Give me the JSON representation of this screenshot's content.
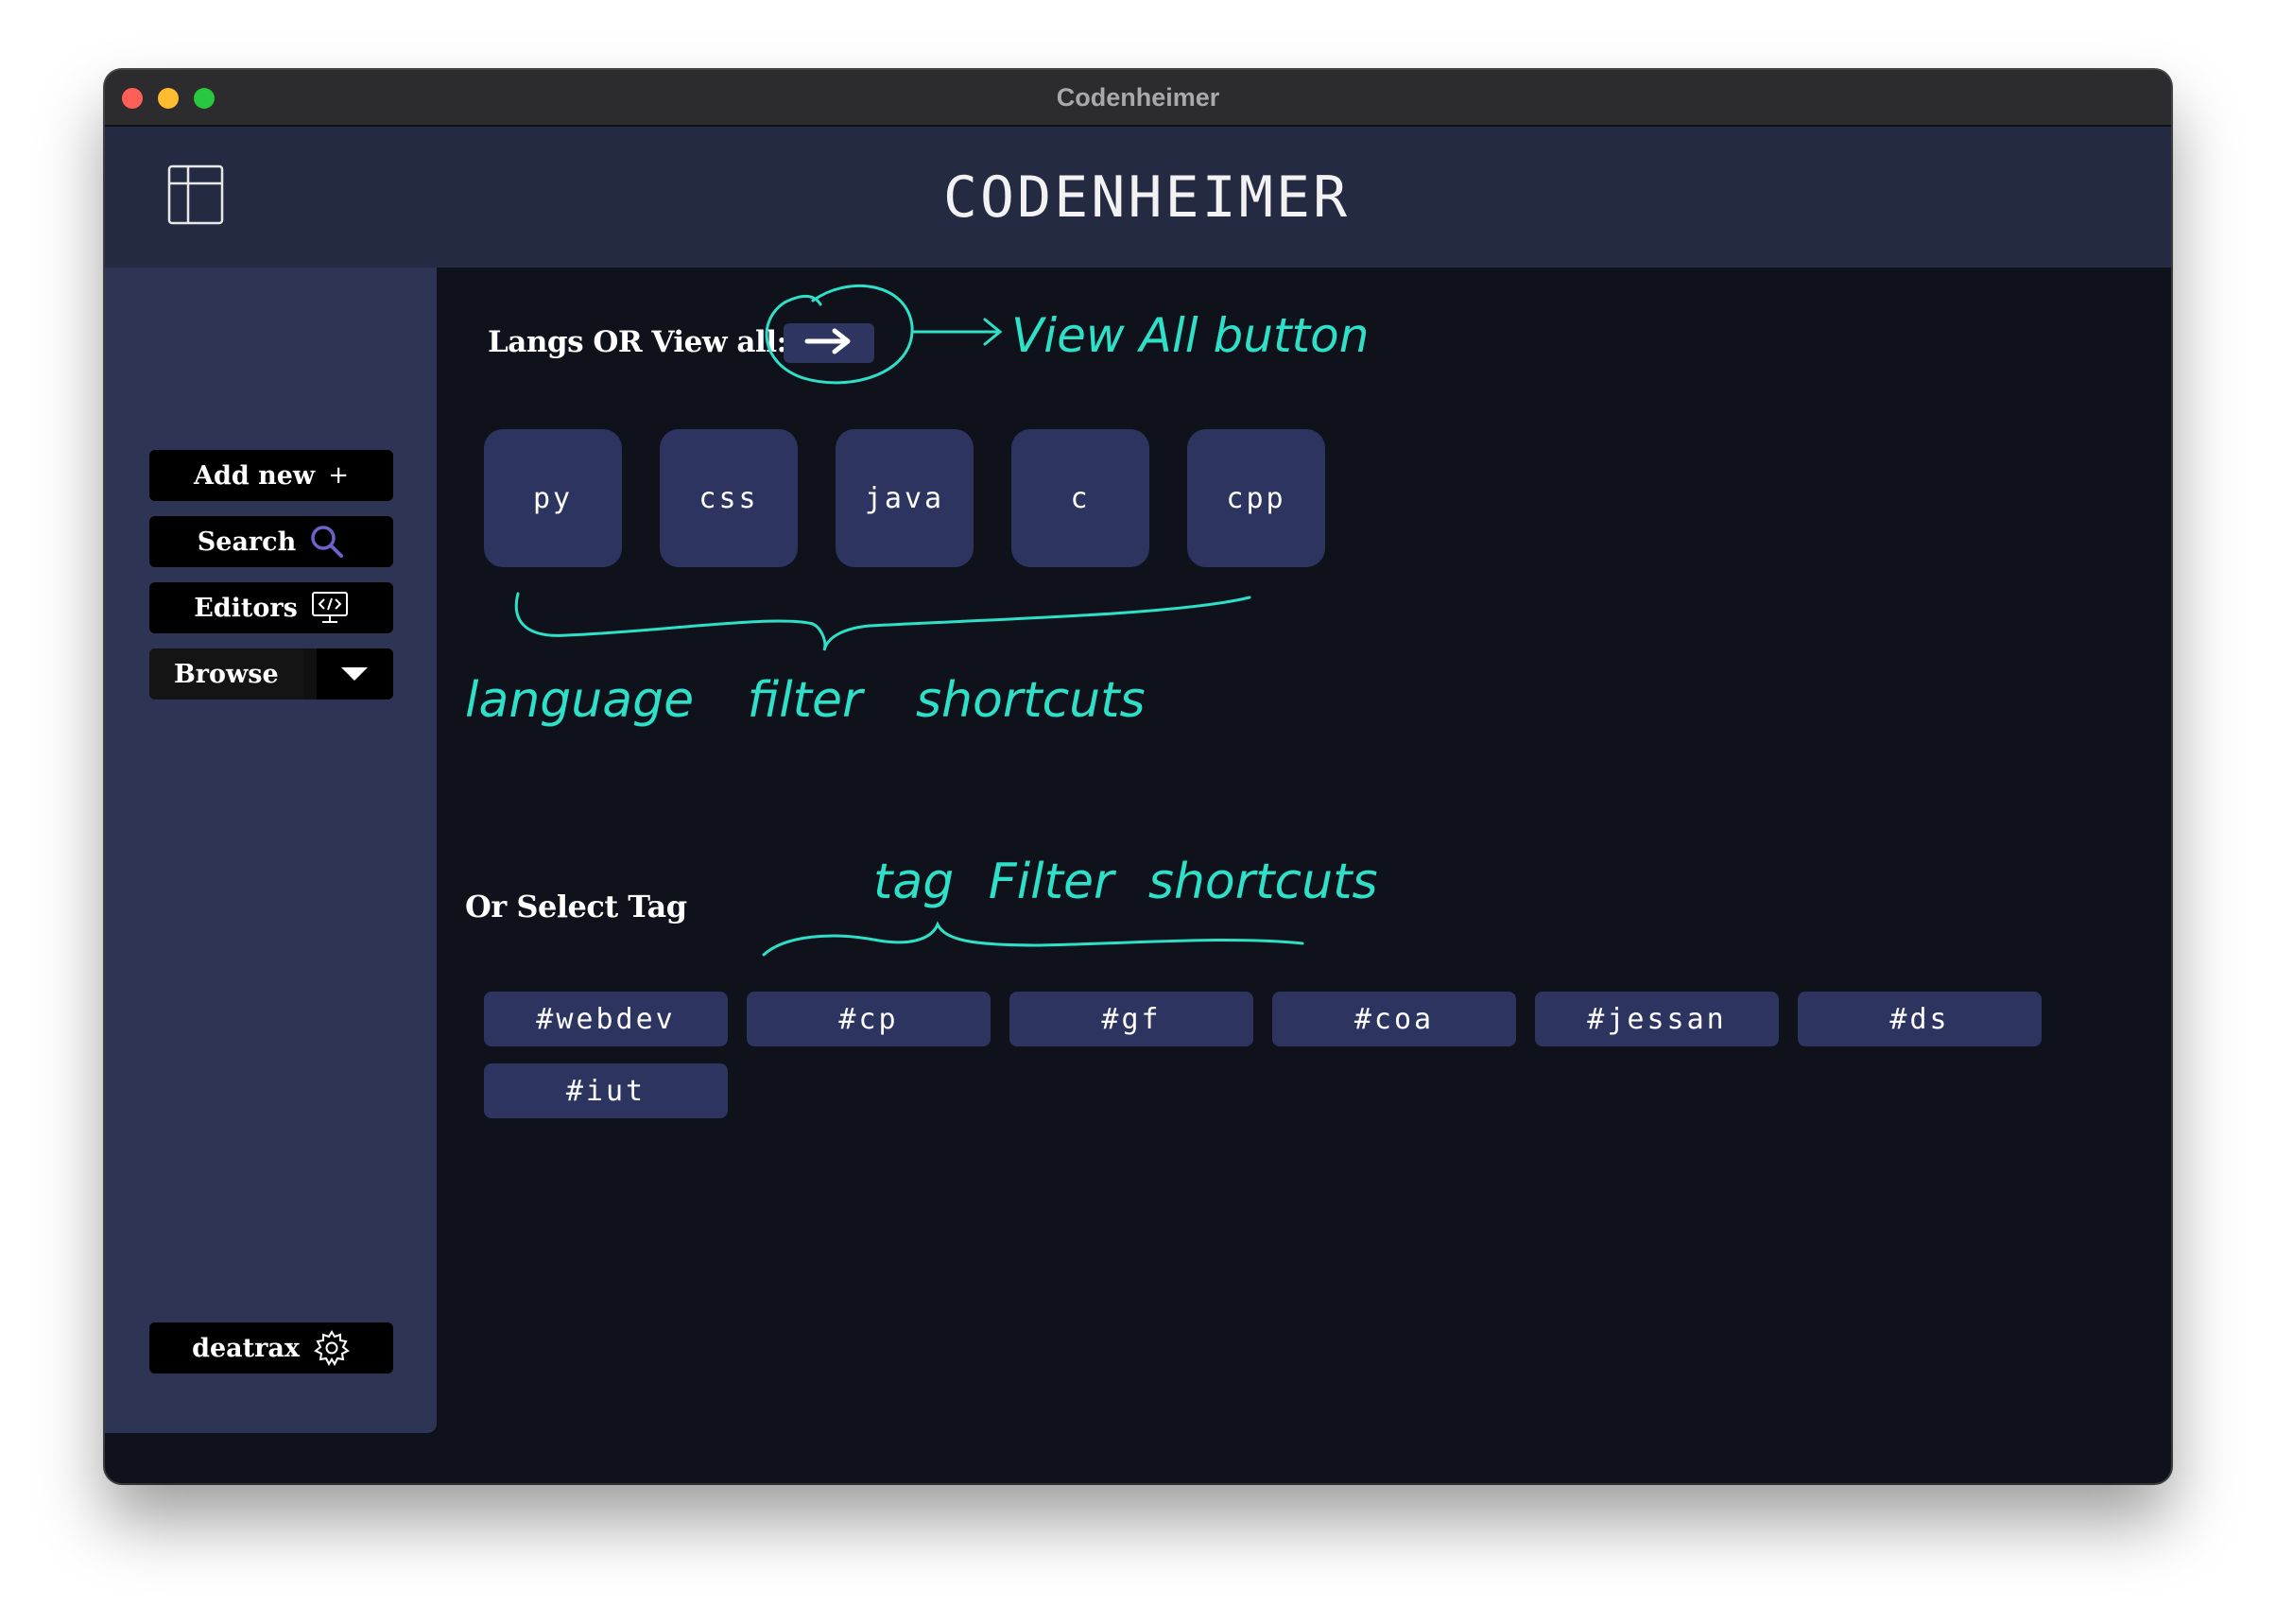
{
  "window": {
    "title": "Codenheimer"
  },
  "header": {
    "app_title": "CODENHEIMER",
    "layout_icon": "layout-panel-icon"
  },
  "sidebar": {
    "add_new": {
      "label": "Add new",
      "icon": "plus-icon",
      "glyph": "+"
    },
    "search": {
      "label": "Search",
      "icon": "magnifier-icon"
    },
    "editors": {
      "label": "Editors",
      "icon": "code-monitor-icon"
    },
    "browse": {
      "label": "Browse",
      "icon": "caret-down-icon"
    },
    "user": {
      "label": "deatrax",
      "icon": "gear-icon"
    }
  },
  "main": {
    "langs_label": "Langs OR View all:",
    "view_all_icon": "arrow-right-icon",
    "languages": [
      "py",
      "css",
      "java",
      "c",
      "cpp"
    ],
    "tags_label": "Or Select Tag",
    "tags": [
      "#webdev",
      "#cp",
      "#gf",
      "#coa",
      "#jessan",
      "#ds",
      "#iut"
    ]
  },
  "annotations": {
    "view_all": "View All button",
    "language_filter": "language filter shortcuts",
    "tag_filter": "tag Filter shortcuts"
  },
  "colors": {
    "header_bg": "#242a42",
    "sidebar_bg": "#2e3554",
    "main_bg": "#0f121b",
    "tile_bg": "#2d3460",
    "annotation": "#2ee0c8",
    "search_icon": "#6b63c9"
  }
}
